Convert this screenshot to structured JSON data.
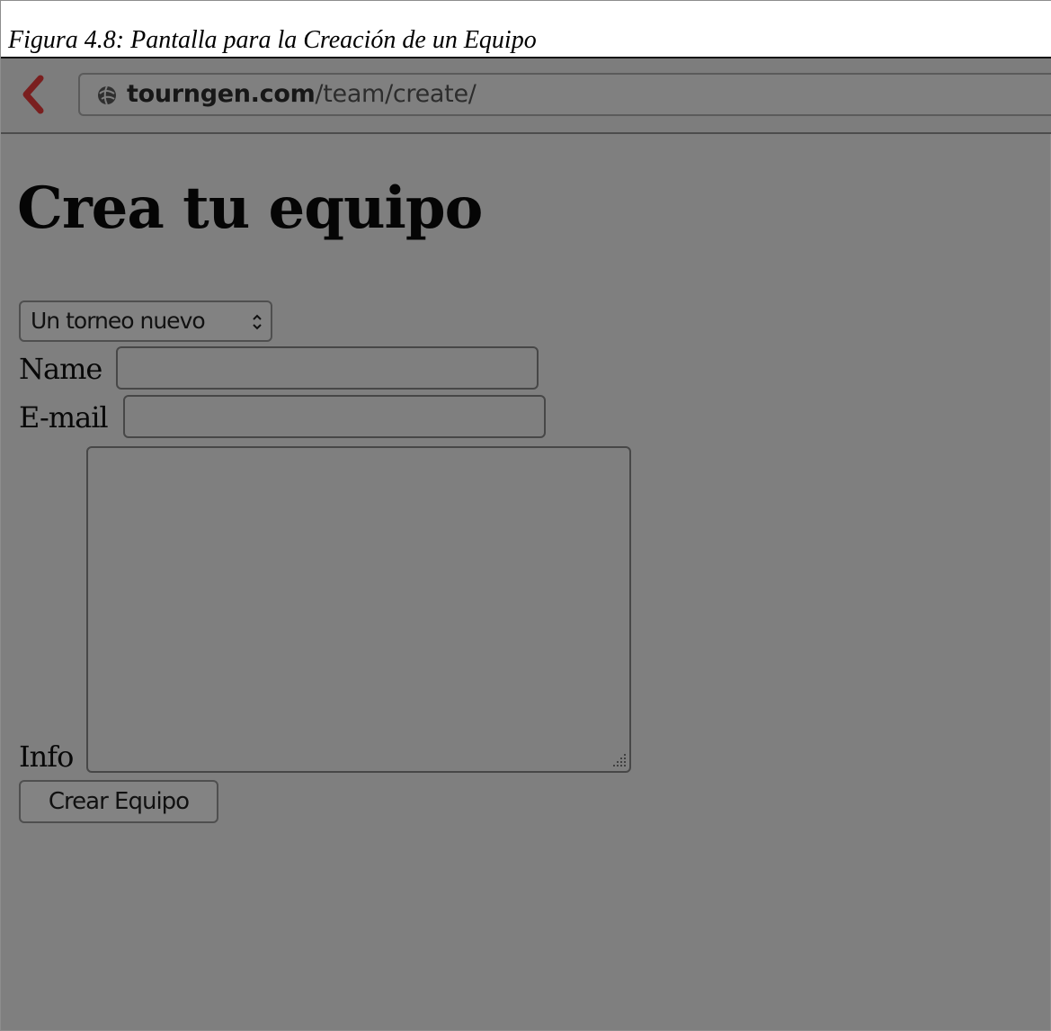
{
  "figure": {
    "caption": "Figura 4.8: Pantalla para la Creación de un Equipo"
  },
  "browser": {
    "back_icon": "chevron-left-icon",
    "site_icon": "globe-icon",
    "url_host": "tourngen.com",
    "url_path": "/team/create/"
  },
  "page": {
    "title": "Crea tu equipo"
  },
  "form": {
    "tournament_select": {
      "selected": "Un torneo nuevo",
      "icon": "select-arrows-icon"
    },
    "name": {
      "label": "Name",
      "value": ""
    },
    "email": {
      "label": "E-mail",
      "value": ""
    },
    "info": {
      "label": "Info",
      "value": ""
    },
    "submit_label": "Crear Equipo"
  },
  "colors": {
    "background": "#7f7f7f",
    "caption_background": "#ffffff",
    "back_accent": "#7a1f1f"
  }
}
